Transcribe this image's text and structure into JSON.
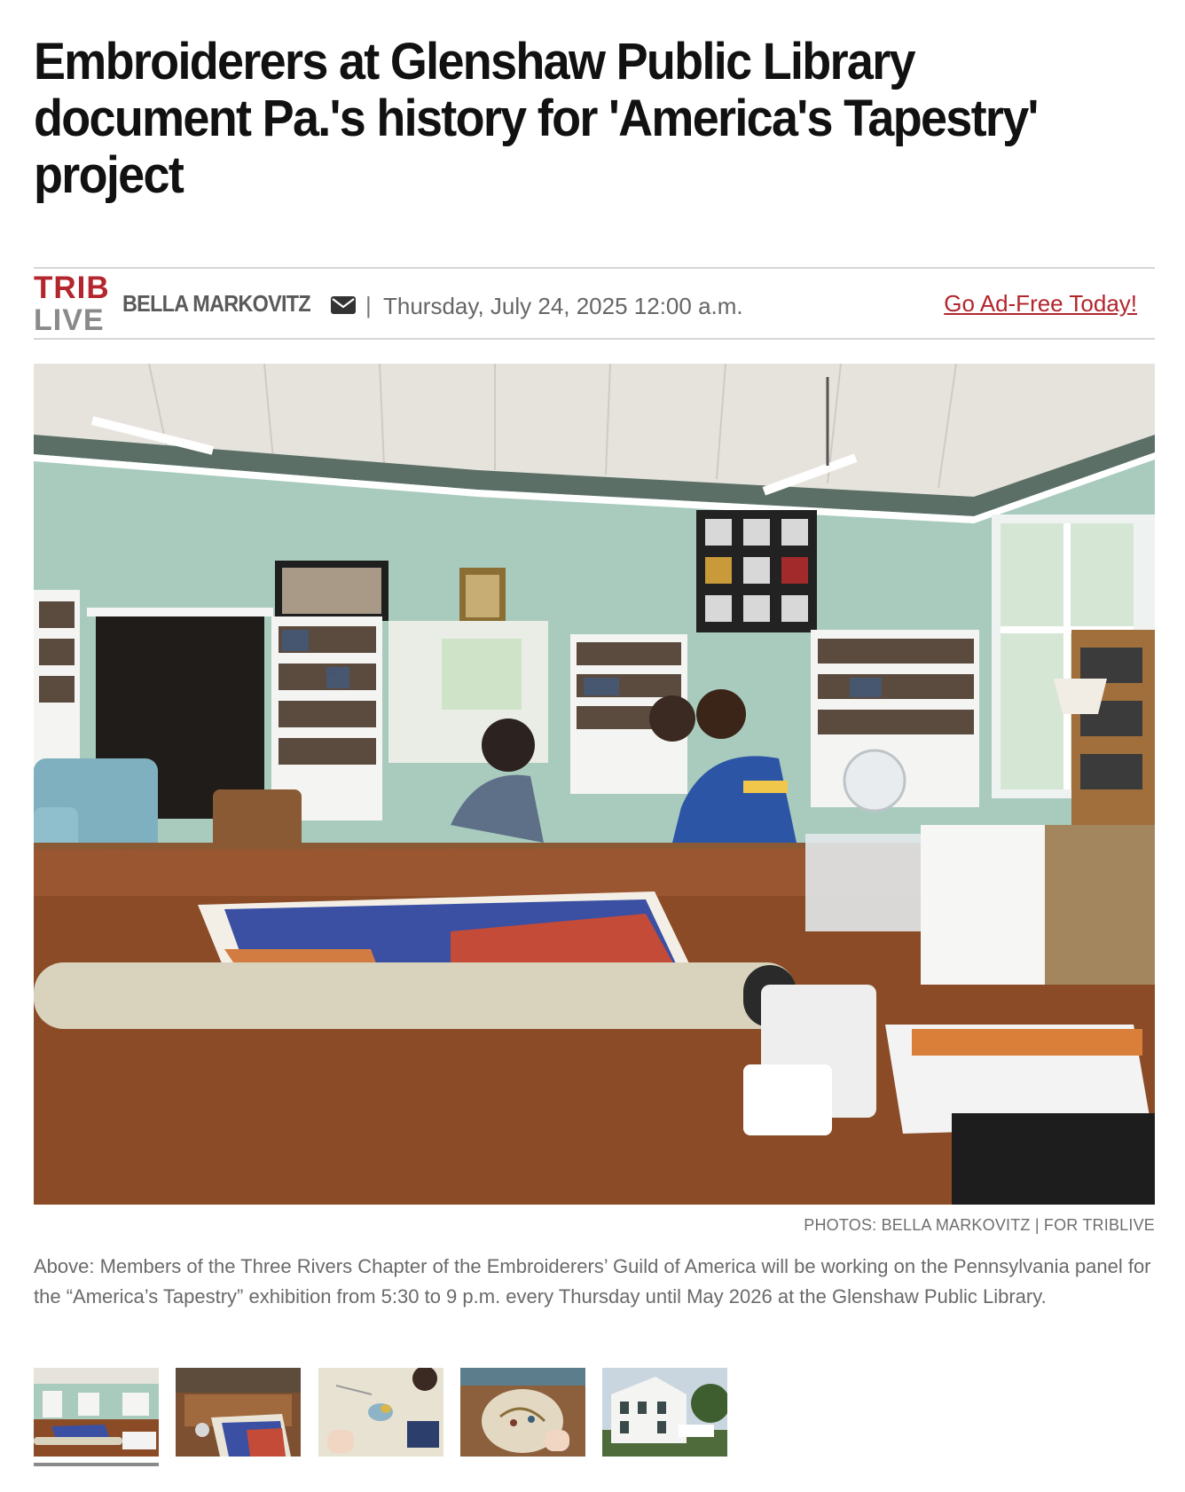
{
  "article": {
    "headline": "Embroiderers at Glenshaw Public Library document Pa.'s history for 'America's Tapestry' project"
  },
  "byline": {
    "logo_top": "TRIB",
    "logo_bottom": "LIVE",
    "author": "BELLA MARKOVITZ",
    "separator": "|",
    "date": "Thursday, July 24, 2025 12:00 a.m.",
    "ad_free_link": "Go Ad-Free Today!"
  },
  "photo": {
    "credit": "PHOTOS: BELLA MARKOVITZ | FOR TRIBLIVE",
    "caption": "Above: Members of the Three Rivers Chapter of the Embroiderers’ Guild of America will be working on the Pennsylvania panel for the “America’s Tapestry” exhibition from 5:30 to 9 p.m. every Thursday until May 2026 at the Glenshaw Public Library."
  },
  "gallery": {
    "thumbnail_count": 5,
    "active_index": 0
  },
  "colors": {
    "brand_red": "#b3262d",
    "muted_gray": "#8a8a8a"
  },
  "icons": {
    "author_contact": "envelope-icon"
  }
}
